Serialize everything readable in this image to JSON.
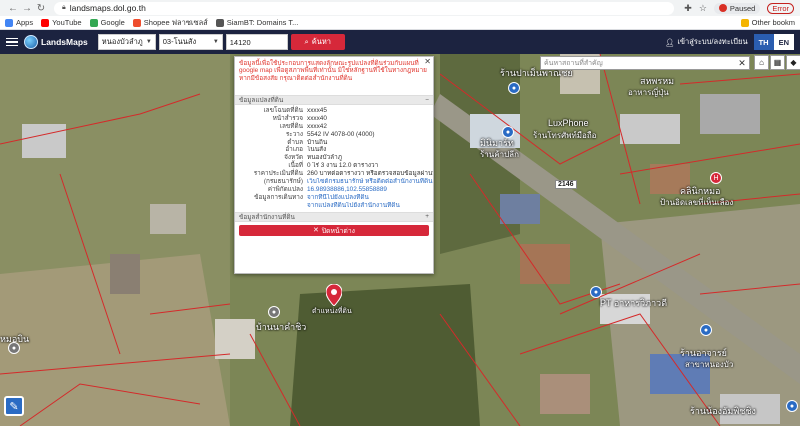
{
  "browser": {
    "url": "landsmaps.dol.go.th",
    "profile_status": "Paused",
    "error_label": "Error",
    "bookmarks": [
      {
        "label": "Apps",
        "color": "#4285f4"
      },
      {
        "label": "YouTube",
        "color": "#ff0000"
      },
      {
        "label": "Google",
        "color": "#34a853"
      },
      {
        "label": "Shopee ฟลาซเซลส์",
        "color": "#ee4d2d"
      },
      {
        "label": "SiamBT: Domains T...",
        "color": "#555555"
      }
    ],
    "other_bookmarks": "Other bookm"
  },
  "app": {
    "logo_text": "LandsMaps",
    "province": "หนองบัวลำภู",
    "district": "03-โนนสัง",
    "postcode": "14120",
    "search_label": "ค้นหา",
    "login_label": "เข้าสู่ระบบ/ลงทะเบียน",
    "lang_th": "TH",
    "lang_en": "EN"
  },
  "map": {
    "search_placeholder": "ค้นหาสถานที่สำคัญ",
    "road_shield": "2146",
    "labels": {
      "shop1": "ร้านปาเม็นพาณิชย์",
      "mobile": "LuxPhone",
      "mobile_sub": "ร้านโทรศัพท์มือถือ",
      "minimart1": "มินิมาร์ท",
      "minimart1_sub": "ร้านค้าปลีก",
      "hotel1": "สหพรหม",
      "hotel1_sub": "อาหารญี่ปุ่น",
      "village": "บ้านนาคำชิว",
      "ptt": "PT อาหารวิภาวดี",
      "clinic": "คลินิกหมอ",
      "clinic_sub": "ป้านอิดเลขที่เห็นเลือง",
      "shop2": "ร้านอาจารย์",
      "shop2_sub": "สาขาหนองบัว",
      "shop3": "ร้านน้องอัมพิชชิง",
      "left_label": "หมอบิน",
      "marker_label": "ตำแหน่งที่ดิน"
    }
  },
  "popup": {
    "note": "ข้อมูลนี้เพื่อใช้ประกอบการแสดงลักษณะรูปแปลงที่ดินร่วมกับแผนที่ google map เพื่อดูสภาพพื้นที่เท่านั้น มิใช่หลักฐานที่ใช้ในทางกฎหมาย หากมีข้อสงสัย กรุณาติดต่อสำนักงานที่ดิน",
    "section_land": "ข้อมูลแปลงที่ดิน",
    "section_office": "ข้อมูลสำนักงานที่ดิน",
    "rows": [
      {
        "k": "เลขโฉนดที่ดิน",
        "v": "xxxx45",
        "link": false
      },
      {
        "k": "หน้าสำรวจ",
        "v": "xxxx40",
        "link": false
      },
      {
        "k": "เลขที่ดิน",
        "v": "xxxx42",
        "link": false
      },
      {
        "k": "ระวาง",
        "v": "5542 IV 4078-00 (4000)",
        "link": false
      },
      {
        "k": "ตำบล",
        "v": "บ้านถิ่น",
        "link": false
      },
      {
        "k": "อำเภอ",
        "v": "โนนสัง",
        "link": false
      },
      {
        "k": "จังหวัด",
        "v": "หนองบัวลำภู",
        "link": false
      },
      {
        "k": "เนื้อที่",
        "v": "0 ไร่ 3 งาน 12.0 ตารางวา",
        "link": false
      },
      {
        "k": "ราคาประเมินที่ดิน",
        "v": "260 บาทต่อตารางวา หรือตรวจสอบข้อมูลผ่านทาง",
        "link": false
      },
      {
        "k": "(กรมธนารักษ์)",
        "v": "เว็บไซต์กรมธนารักษ์ หรือติดต่อสำนักงานที่ดิน",
        "link": true
      },
      {
        "k": "ค่าพิกัดแปลง",
        "v": "16.98938886,102.55858889",
        "link": true
      },
      {
        "k": "ข้อมูลการเดินทาง",
        "v": "จากที่นี่ไปยังแปลงที่ดิน",
        "link": true
      },
      {
        "k": "",
        "v": "จากแปลงที่ดินไปยังสำนักงานที่ดิน",
        "link": true
      }
    ],
    "close_label": "ปิดหน้าต่าง"
  },
  "colors": {
    "header_bg": "#1c2340",
    "accent_red": "#d6283a",
    "parcel_line": "#d42a2a"
  }
}
